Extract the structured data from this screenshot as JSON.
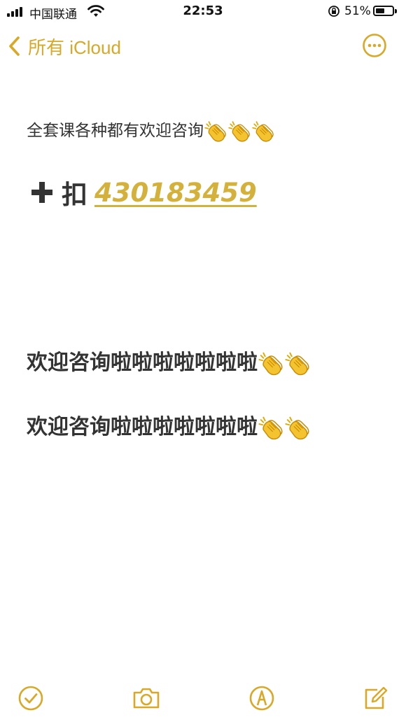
{
  "status_bar": {
    "carrier": "中国联通",
    "time": "22:53",
    "battery_percent": "51%",
    "battery_level": 0.51,
    "signal_bars": 4
  },
  "nav": {
    "back_label": "所有 iCloud",
    "more_icon": "ellipsis-circle-icon"
  },
  "note": {
    "line1": "全套课各种都有欢迎咨询",
    "line1_emoji_count": 3,
    "line2_prefix": "扣",
    "line2_phone": "430183459",
    "line3": "欢迎咨询啦啦啦啦啦啦啦",
    "line3_emoji_count": 2,
    "line4": "欢迎咨询啦啦啦啦啦啦啦",
    "line4_emoji_count": 2
  },
  "toolbar": {
    "items": [
      "checklist-icon",
      "camera-icon",
      "markup-icon",
      "compose-icon"
    ]
  },
  "colors": {
    "accent": "#d9a827",
    "link": "#d4b13a",
    "text": "#333333",
    "emoji_skin": "#f4c430"
  }
}
